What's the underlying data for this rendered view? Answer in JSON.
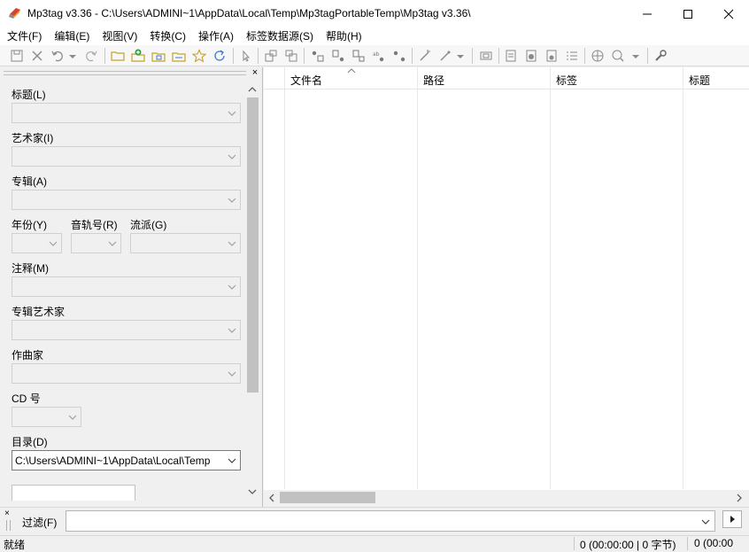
{
  "window": {
    "title": "Mp3tag v3.36  -  C:\\Users\\ADMINI~1\\AppData\\Local\\Temp\\Mp3tagPortableTemp\\Mp3tag v3.36\\"
  },
  "menu": [
    "文件(F)",
    "编辑(E)",
    "视图(V)",
    "转换(C)",
    "操作(A)",
    "标签数据源(S)",
    "帮助(H)"
  ],
  "fields": {
    "title": "标题(L)",
    "artist": "艺术家(I)",
    "album": "专辑(A)",
    "year": "年份(Y)",
    "track": "音轨号(R)",
    "genre": "流派(G)",
    "comment": "注释(M)",
    "album_artist": "专辑艺术家",
    "composer": "作曲家",
    "disc": "CD 号",
    "directory": "目录(D)",
    "directory_value": "C:\\Users\\ADMINI~1\\AppData\\Local\\Temp"
  },
  "columns": [
    "文件名",
    "路径",
    "标签",
    "标题"
  ],
  "filter": {
    "label": "过滤(F)",
    "value": ""
  },
  "status": {
    "left": "就绪",
    "selected": "0 (00:00:00 | 0 字节)",
    "total": "0 (00:00"
  },
  "colors": {
    "accent": "#c0392b",
    "scroll_thumb": "#c1c1c1"
  }
}
